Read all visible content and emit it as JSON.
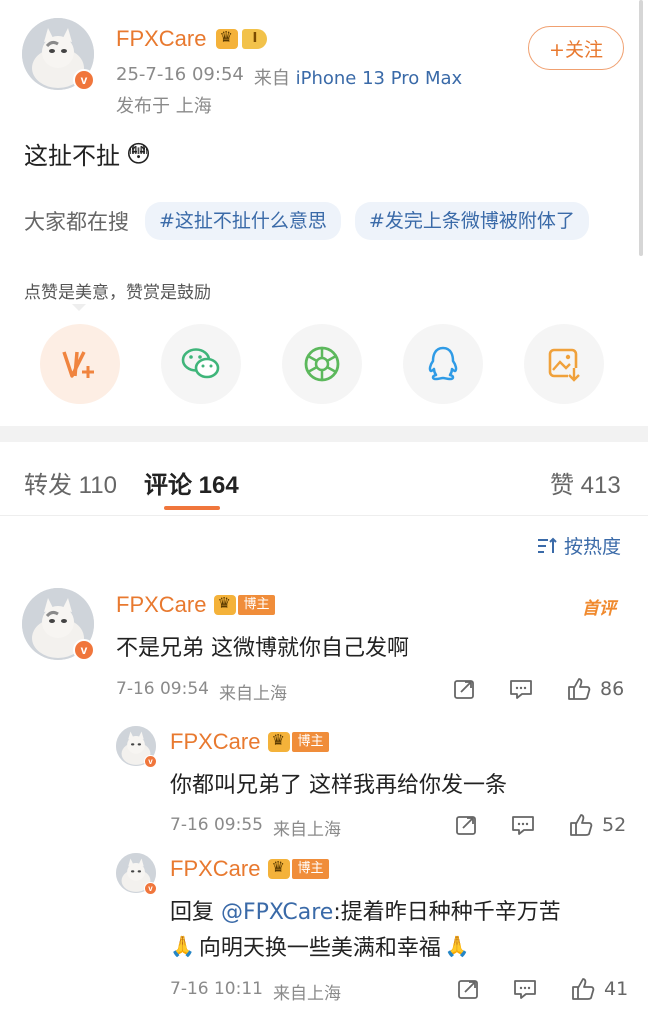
{
  "post": {
    "author": "FPXCare",
    "level_badge": "I",
    "date": "25-7-16 09:54",
    "from_label": "来自",
    "device": "iPhone 13 Pro Max",
    "location": "发布于 上海",
    "follow_label": "+关注",
    "content": "这扯不扯",
    "content_emoji": "😳"
  },
  "search": {
    "label": "大家都在搜",
    "tags": [
      "#这扯不扯什么意思",
      "#发完上条微博被附体了"
    ]
  },
  "reward_hint": "点赞是美意，赞赏是鼓励",
  "share_icons": [
    "reward-icon",
    "wechat-icon",
    "moments-icon",
    "qq-icon",
    "save-image-icon"
  ],
  "tabs": {
    "repost": "转发 110",
    "comment": "评论 164",
    "like": "赞 413"
  },
  "sort_label": "按热度",
  "colors": {
    "accent": "#e8792f",
    "link": "#3a6aa8",
    "tab_underline": "#f0763c"
  },
  "comments": [
    {
      "author": "FPXCare",
      "author_badge": "博主",
      "first_label": "首评",
      "text": "不是兄弟 这微博就你自己发啊",
      "time": "7-16 09:54",
      "location": "来自上海",
      "likes": "86"
    },
    {
      "author": "FPXCare",
      "author_badge": "博主",
      "text": "你都叫兄弟了 这样我再给你发一条",
      "time": "7-16 09:55",
      "location": "来自上海",
      "likes": "52"
    },
    {
      "author": "FPXCare",
      "author_badge": "博主",
      "reply_prefix": "回复 ",
      "mention": "@FPXCare",
      "text_line1": ":提着昨日种种千辛万苦",
      "text_line2": "向明天换一些美满和幸福",
      "time": "7-16 10:11",
      "location": "来自上海",
      "likes": "41"
    }
  ]
}
